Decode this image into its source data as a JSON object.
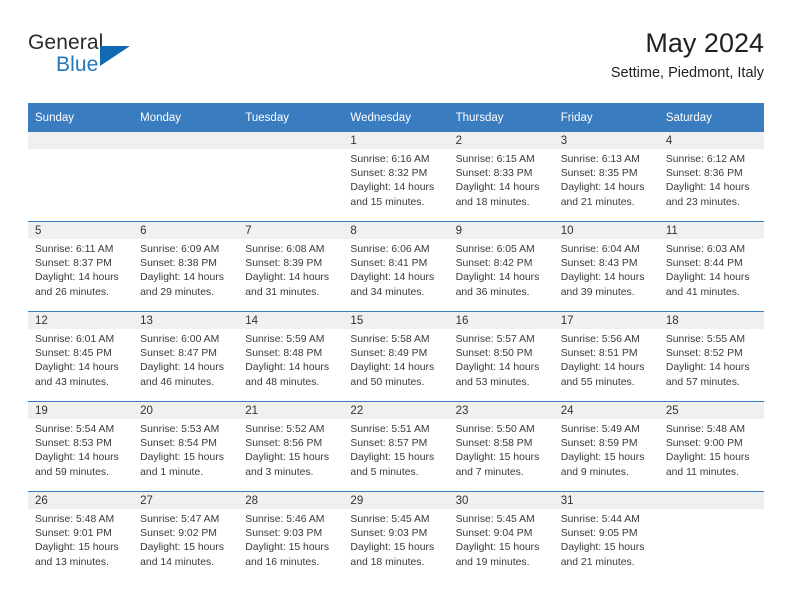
{
  "brand": {
    "word1": "General",
    "word2": "Blue",
    "triangle_color": "#1168b3",
    "blue_text_color": "#2277bb"
  },
  "header": {
    "title": "May 2024",
    "subtitle": "Settime, Piedmont, Italy"
  },
  "theme": {
    "header_blue": "#3a7cc0",
    "date_band_gray": "#f0f0f0",
    "text_color": "#231f20"
  },
  "weekday_headers": [
    "Sunday",
    "Monday",
    "Tuesday",
    "Wednesday",
    "Thursday",
    "Friday",
    "Saturday"
  ],
  "weeks": [
    [
      {
        "day": "",
        "lines": []
      },
      {
        "day": "",
        "lines": []
      },
      {
        "day": "",
        "lines": []
      },
      {
        "day": "1",
        "lines": [
          "Sunrise: 6:16 AM",
          "Sunset: 8:32 PM",
          "Daylight: 14 hours",
          "and 15 minutes."
        ]
      },
      {
        "day": "2",
        "lines": [
          "Sunrise: 6:15 AM",
          "Sunset: 8:33 PM",
          "Daylight: 14 hours",
          "and 18 minutes."
        ]
      },
      {
        "day": "3",
        "lines": [
          "Sunrise: 6:13 AM",
          "Sunset: 8:35 PM",
          "Daylight: 14 hours",
          "and 21 minutes."
        ]
      },
      {
        "day": "4",
        "lines": [
          "Sunrise: 6:12 AM",
          "Sunset: 8:36 PM",
          "Daylight: 14 hours",
          "and 23 minutes."
        ]
      }
    ],
    [
      {
        "day": "5",
        "lines": [
          "Sunrise: 6:11 AM",
          "Sunset: 8:37 PM",
          "Daylight: 14 hours",
          "and 26 minutes."
        ]
      },
      {
        "day": "6",
        "lines": [
          "Sunrise: 6:09 AM",
          "Sunset: 8:38 PM",
          "Daylight: 14 hours",
          "and 29 minutes."
        ]
      },
      {
        "day": "7",
        "lines": [
          "Sunrise: 6:08 AM",
          "Sunset: 8:39 PM",
          "Daylight: 14 hours",
          "and 31 minutes."
        ]
      },
      {
        "day": "8",
        "lines": [
          "Sunrise: 6:06 AM",
          "Sunset: 8:41 PM",
          "Daylight: 14 hours",
          "and 34 minutes."
        ]
      },
      {
        "day": "9",
        "lines": [
          "Sunrise: 6:05 AM",
          "Sunset: 8:42 PM",
          "Daylight: 14 hours",
          "and 36 minutes."
        ]
      },
      {
        "day": "10",
        "lines": [
          "Sunrise: 6:04 AM",
          "Sunset: 8:43 PM",
          "Daylight: 14 hours",
          "and 39 minutes."
        ]
      },
      {
        "day": "11",
        "lines": [
          "Sunrise: 6:03 AM",
          "Sunset: 8:44 PM",
          "Daylight: 14 hours",
          "and 41 minutes."
        ]
      }
    ],
    [
      {
        "day": "12",
        "lines": [
          "Sunrise: 6:01 AM",
          "Sunset: 8:45 PM",
          "Daylight: 14 hours",
          "and 43 minutes."
        ]
      },
      {
        "day": "13",
        "lines": [
          "Sunrise: 6:00 AM",
          "Sunset: 8:47 PM",
          "Daylight: 14 hours",
          "and 46 minutes."
        ]
      },
      {
        "day": "14",
        "lines": [
          "Sunrise: 5:59 AM",
          "Sunset: 8:48 PM",
          "Daylight: 14 hours",
          "and 48 minutes."
        ]
      },
      {
        "day": "15",
        "lines": [
          "Sunrise: 5:58 AM",
          "Sunset: 8:49 PM",
          "Daylight: 14 hours",
          "and 50 minutes."
        ]
      },
      {
        "day": "16",
        "lines": [
          "Sunrise: 5:57 AM",
          "Sunset: 8:50 PM",
          "Daylight: 14 hours",
          "and 53 minutes."
        ]
      },
      {
        "day": "17",
        "lines": [
          "Sunrise: 5:56 AM",
          "Sunset: 8:51 PM",
          "Daylight: 14 hours",
          "and 55 minutes."
        ]
      },
      {
        "day": "18",
        "lines": [
          "Sunrise: 5:55 AM",
          "Sunset: 8:52 PM",
          "Daylight: 14 hours",
          "and 57 minutes."
        ]
      }
    ],
    [
      {
        "day": "19",
        "lines": [
          "Sunrise: 5:54 AM",
          "Sunset: 8:53 PM",
          "Daylight: 14 hours",
          "and 59 minutes."
        ]
      },
      {
        "day": "20",
        "lines": [
          "Sunrise: 5:53 AM",
          "Sunset: 8:54 PM",
          "Daylight: 15 hours",
          "and 1 minute."
        ]
      },
      {
        "day": "21",
        "lines": [
          "Sunrise: 5:52 AM",
          "Sunset: 8:56 PM",
          "Daylight: 15 hours",
          "and 3 minutes."
        ]
      },
      {
        "day": "22",
        "lines": [
          "Sunrise: 5:51 AM",
          "Sunset: 8:57 PM",
          "Daylight: 15 hours",
          "and 5 minutes."
        ]
      },
      {
        "day": "23",
        "lines": [
          "Sunrise: 5:50 AM",
          "Sunset: 8:58 PM",
          "Daylight: 15 hours",
          "and 7 minutes."
        ]
      },
      {
        "day": "24",
        "lines": [
          "Sunrise: 5:49 AM",
          "Sunset: 8:59 PM",
          "Daylight: 15 hours",
          "and 9 minutes."
        ]
      },
      {
        "day": "25",
        "lines": [
          "Sunrise: 5:48 AM",
          "Sunset: 9:00 PM",
          "Daylight: 15 hours",
          "and 11 minutes."
        ]
      }
    ],
    [
      {
        "day": "26",
        "lines": [
          "Sunrise: 5:48 AM",
          "Sunset: 9:01 PM",
          "Daylight: 15 hours",
          "and 13 minutes."
        ]
      },
      {
        "day": "27",
        "lines": [
          "Sunrise: 5:47 AM",
          "Sunset: 9:02 PM",
          "Daylight: 15 hours",
          "and 14 minutes."
        ]
      },
      {
        "day": "28",
        "lines": [
          "Sunrise: 5:46 AM",
          "Sunset: 9:03 PM",
          "Daylight: 15 hours",
          "and 16 minutes."
        ]
      },
      {
        "day": "29",
        "lines": [
          "Sunrise: 5:45 AM",
          "Sunset: 9:03 PM",
          "Daylight: 15 hours",
          "and 18 minutes."
        ]
      },
      {
        "day": "30",
        "lines": [
          "Sunrise: 5:45 AM",
          "Sunset: 9:04 PM",
          "Daylight: 15 hours",
          "and 19 minutes."
        ]
      },
      {
        "day": "31",
        "lines": [
          "Sunrise: 5:44 AM",
          "Sunset: 9:05 PM",
          "Daylight: 15 hours",
          "and 21 minutes."
        ]
      },
      {
        "day": "",
        "lines": []
      }
    ]
  ]
}
